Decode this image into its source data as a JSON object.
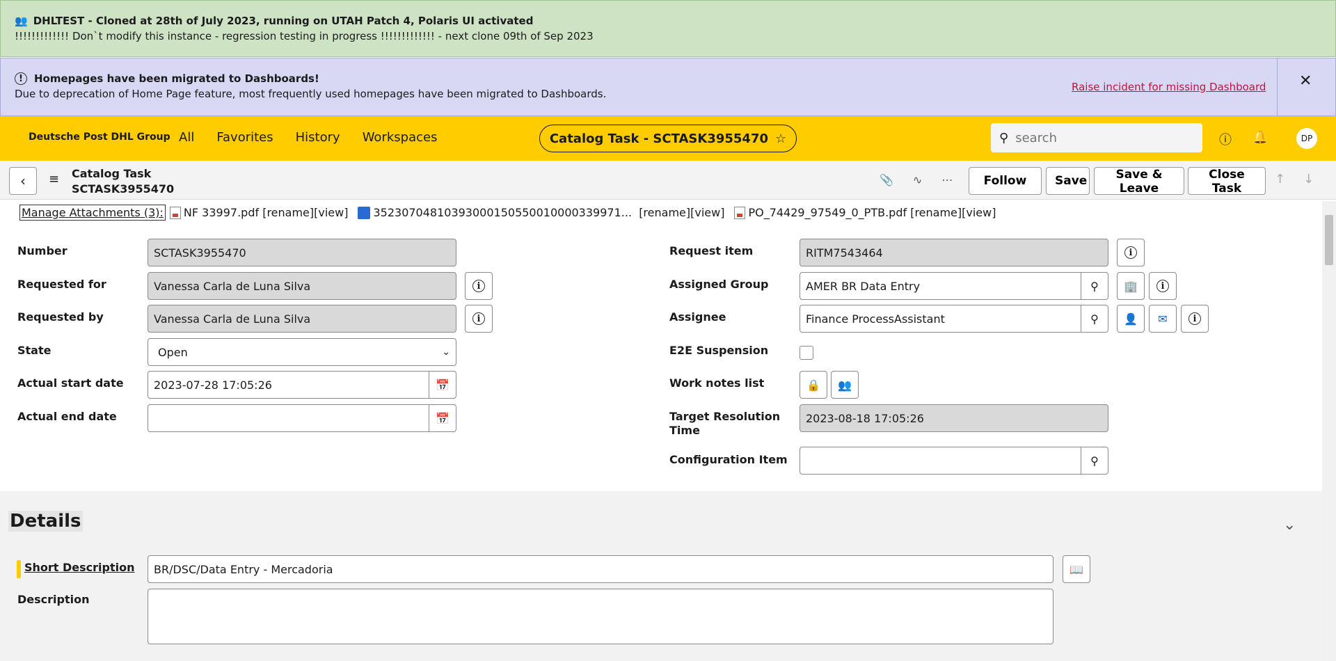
{
  "banner_instance": {
    "title": "DHLTEST - Cloned at 28th of July 2023, running on UTAH Patch 4, Polaris UI activated",
    "message": "!!!!!!!!!!!!! Don`t modify this instance - regression testing in progress !!!!!!!!!!!!! - next clone 09th of Sep 2023"
  },
  "banner_migration": {
    "title": "Homepages have been migrated to Dashboards!",
    "message": "Due to deprecation of Home Page feature, most frequently used homepages have been migrated to Dashboards.",
    "link": "Raise incident for missing Dashboard"
  },
  "header": {
    "brand": "Deutsche Post DHL Group",
    "nav": [
      "All",
      "Favorites",
      "History",
      "Workspaces"
    ],
    "context": "Catalog Task - SCTASK3955470",
    "search_placeholder": "search",
    "avatar": "DP"
  },
  "form_header": {
    "table": "Catalog Task",
    "number": "SCTASK3955470",
    "buttons": {
      "follow": "Follow",
      "save": "Save",
      "save_leave": "Save & Leave",
      "close_task": "Close Task"
    }
  },
  "attachments": {
    "manage": "Manage Attachments (3):",
    "files": [
      {
        "name": "NF 33997.pdf",
        "rename": "[rename]",
        "view": "[view]"
      },
      {
        "name": "35230704810393000150550010000339971...",
        "rename": "[rename]",
        "view": "[view]"
      },
      {
        "name": "PO_74429_97549_0_PTB.pdf",
        "rename": "[rename]",
        "view": "[view]"
      }
    ]
  },
  "form": {
    "left": {
      "number": {
        "label": "Number",
        "value": "SCTASK3955470"
      },
      "requested_for": {
        "label": "Requested for",
        "value": "Vanessa Carla de Luna Silva"
      },
      "requested_by": {
        "label": "Requested by",
        "value": "Vanessa Carla de Luna Silva"
      },
      "state": {
        "label": "State",
        "value": "Open"
      },
      "actual_start": {
        "label": "Actual start date",
        "value": "2023-07-28 17:05:26"
      },
      "actual_end": {
        "label": "Actual end date",
        "value": ""
      }
    },
    "right": {
      "request_item": {
        "label": "Request item",
        "value": "RITM7543464"
      },
      "assigned_group": {
        "label": "Assigned Group",
        "value": "AMER BR Data Entry"
      },
      "assignee": {
        "label": "Assignee",
        "value": "Finance ProcessAssistant"
      },
      "e2e": {
        "label": "E2E Suspension"
      },
      "work_notes": {
        "label": "Work notes list"
      },
      "target_resolution": {
        "label": "Target Resolution Time",
        "value": "2023-08-18 17:05:26"
      },
      "config_item": {
        "label": "Configuration Item",
        "value": ""
      }
    }
  },
  "details": {
    "title": "Details",
    "short_description": {
      "label": "Short Description",
      "value": "BR/DSC/Data Entry - Mercadoria"
    },
    "description": {
      "label": "Description",
      "value": ""
    }
  }
}
